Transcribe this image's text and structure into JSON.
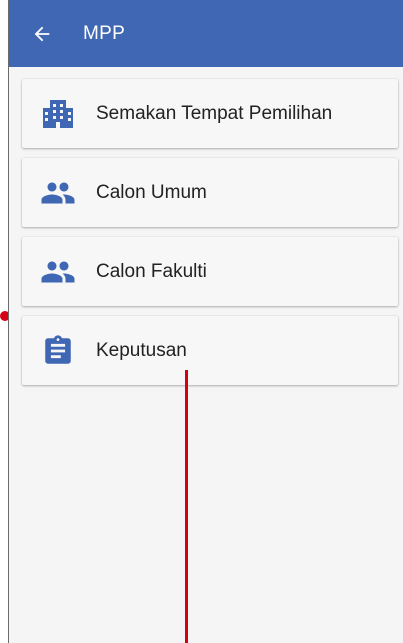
{
  "app_bar": {
    "title": "MPP",
    "back_icon": "arrow-back-icon",
    "color": "#3f67b4"
  },
  "menu": {
    "items": [
      {
        "label": "Semakan Tempat Pemilihan",
        "icon": "building-icon"
      },
      {
        "label": "Calon Umum",
        "icon": "people-icon"
      },
      {
        "label": "Calon Fakulti",
        "icon": "people-icon"
      },
      {
        "label": "Keputusan",
        "icon": "clipboard-icon"
      }
    ],
    "icon_color": "#3f67b4"
  },
  "annotation": {
    "color": "#d50012"
  }
}
